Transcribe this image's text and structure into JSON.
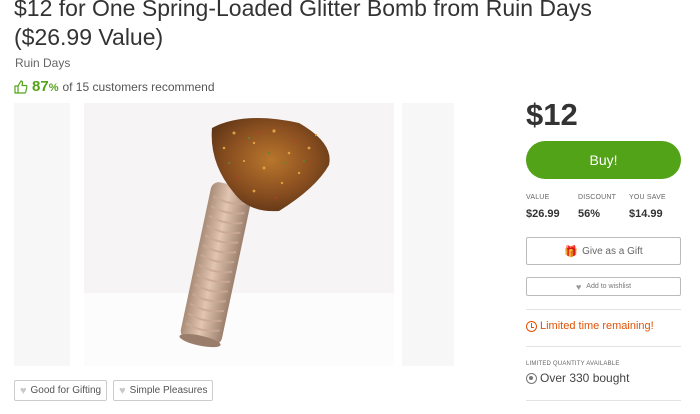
{
  "deal": {
    "title": "$12 for One Spring-Loaded Glitter Bomb from Ruin Days ($26.99 Value)",
    "merchant": "Ruin Days",
    "recommend_pct": "87",
    "recommend_pct_sign": "%",
    "recommend_text": "of 15 customers recommend",
    "tags": [
      {
        "label": "Good for Gifting",
        "icon": "heart-icon"
      },
      {
        "label": "Simple Pleasures",
        "icon": "heart-icon"
      }
    ]
  },
  "purchase": {
    "price": "$12",
    "buy_label": "Buy!",
    "stats": [
      {
        "label": "VALUE",
        "value": "$26.99"
      },
      {
        "label": "DISCOUNT",
        "value": "56%"
      },
      {
        "label": "YOU SAVE",
        "value": "$14.99"
      }
    ],
    "gift_label": "Give as a Gift",
    "wishlist_label": "Add to wishlist",
    "limited_text": "Limited time remaining!",
    "limited_quantity_label": "LIMITED QUANTITY AVAILABLE",
    "bought_text": "Over 330 bought"
  },
  "colors": {
    "accent_green": "#53a318",
    "urgent_orange": "#e35205"
  }
}
